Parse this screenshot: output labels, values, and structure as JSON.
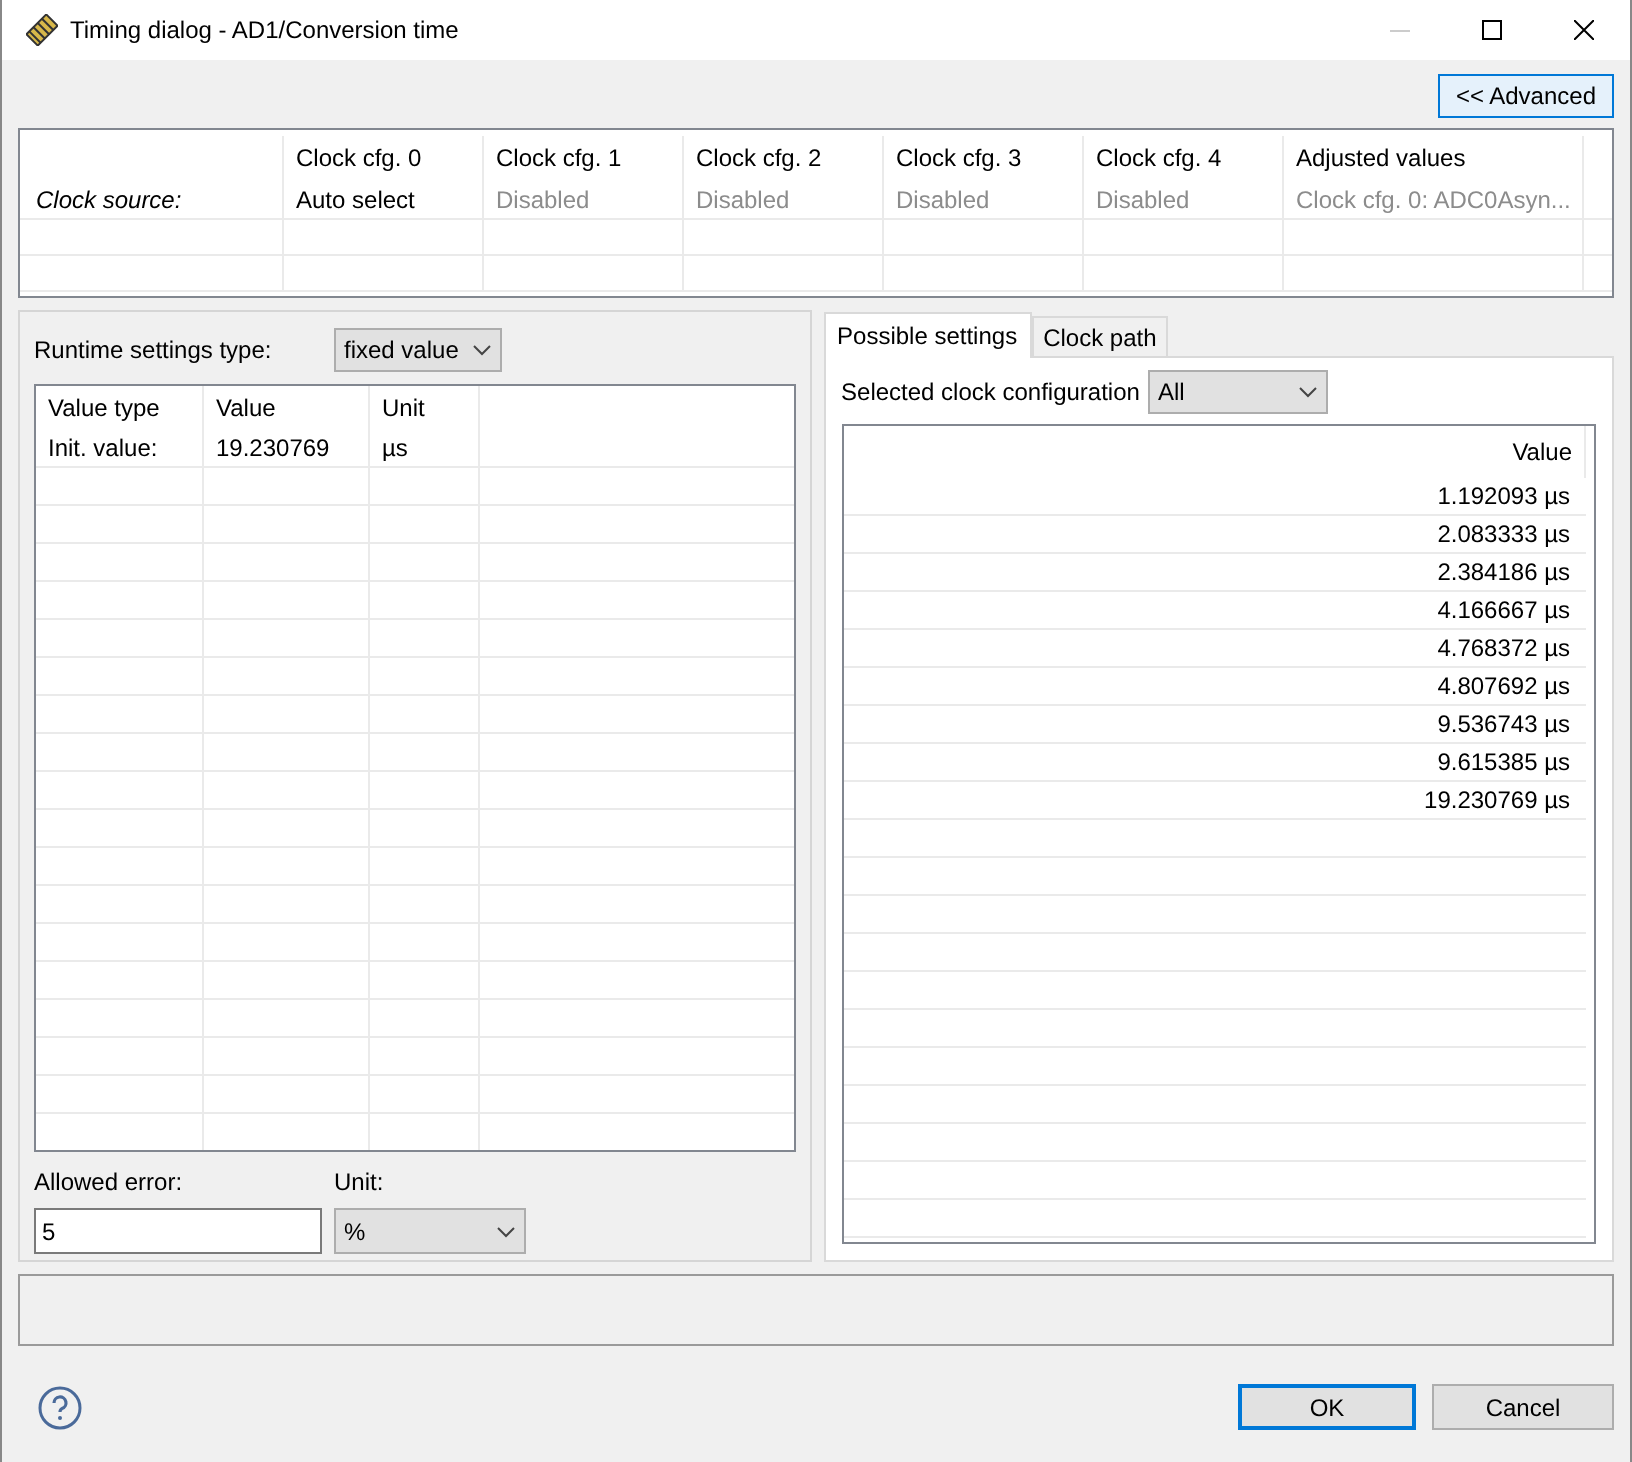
{
  "window": {
    "title": "Timing dialog - AD1/Conversion time",
    "minimize_disabled": true
  },
  "advanced_button": {
    "label": "<< Advanced"
  },
  "clock_table": {
    "columns": [
      "",
      "Clock cfg. 0",
      "Clock cfg. 1",
      "Clock cfg. 2",
      "Clock cfg. 3",
      "Clock cfg. 4",
      "Adjusted values"
    ],
    "rows": [
      {
        "cells": [
          {
            "text": "Clock source:",
            "kind": "label",
            "disabled": false
          },
          {
            "text": "Auto select",
            "kind": "value",
            "disabled": false
          },
          {
            "text": "Disabled",
            "kind": "value",
            "disabled": true
          },
          {
            "text": "Disabled",
            "kind": "value",
            "disabled": true
          },
          {
            "text": "Disabled",
            "kind": "value",
            "disabled": true
          },
          {
            "text": "Disabled",
            "kind": "value",
            "disabled": true
          },
          {
            "text": "Clock cfg. 0: ADC0Asyn...",
            "kind": "value",
            "disabled": true
          }
        ]
      }
    ]
  },
  "runtime": {
    "label": "Runtime settings type:",
    "value": "fixed value",
    "table": {
      "columns": [
        "Value type",
        "Value",
        "Unit"
      ],
      "rows": [
        [
          "Init. value:",
          "19.230769",
          "µs"
        ]
      ]
    },
    "allowed_error": {
      "label": "Allowed error:",
      "value": "5"
    },
    "unit": {
      "label": "Unit:",
      "value": "%"
    }
  },
  "tabs": [
    {
      "label": "Possible settings",
      "selected": true
    },
    {
      "label": "Clock path",
      "selected": false
    }
  ],
  "possible_settings": {
    "config_label": "Selected clock configuration",
    "config_value": "All",
    "column": "Value",
    "values": [
      "1.192093 µs",
      "2.083333 µs",
      "2.384186 µs",
      "4.166667 µs",
      "4.768372 µs",
      "4.807692 µs",
      "9.536743 µs",
      "9.615385 µs",
      "19.230769 µs"
    ]
  },
  "buttons": [
    {
      "label": "OK",
      "default": true
    },
    {
      "label": "Cancel",
      "default": false
    }
  ]
}
